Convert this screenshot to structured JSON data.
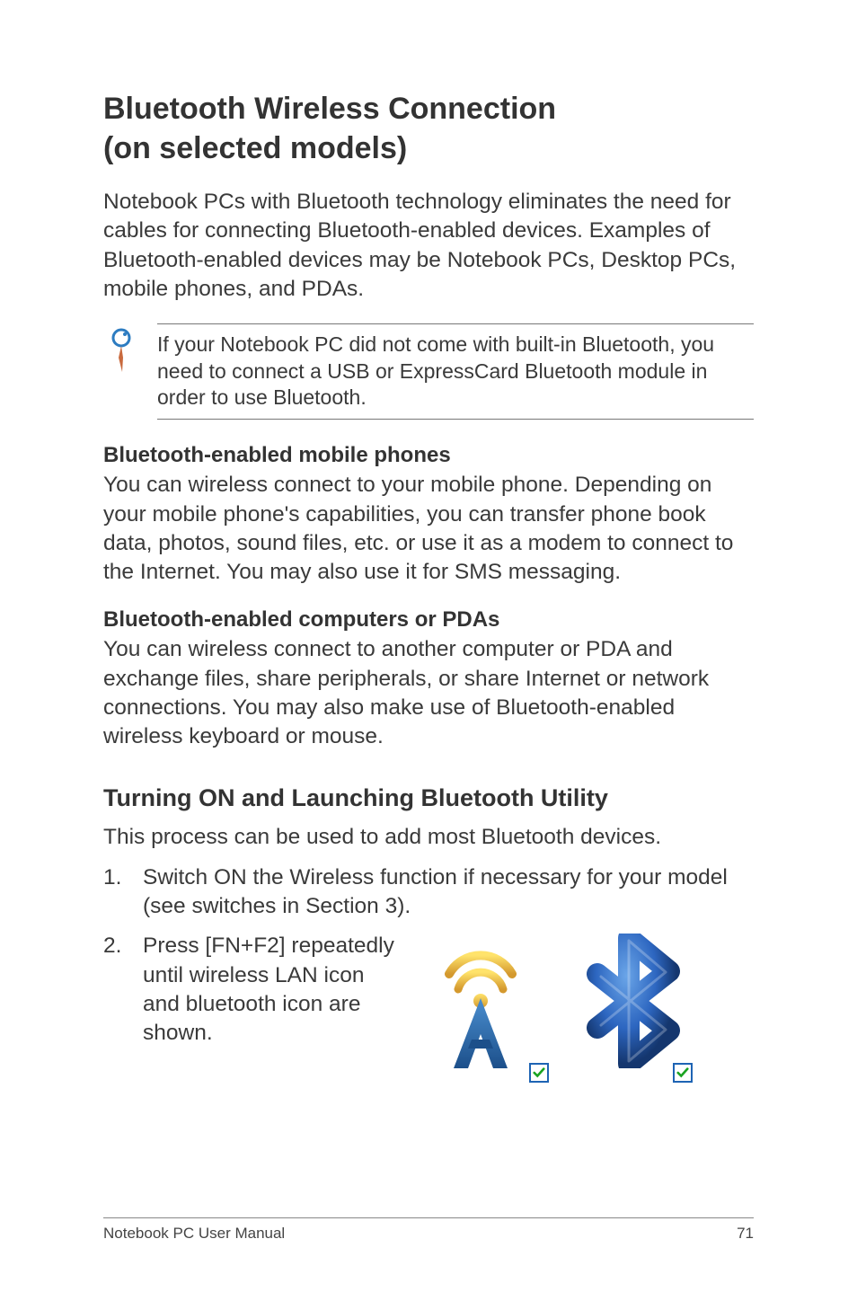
{
  "title_line1": "Bluetooth Wireless Connection",
  "title_line2": "(on selected models)",
  "intro": "Notebook PCs with Bluetooth technology eliminates the need for cables for connecting Bluetooth-enabled devices. Examples of Bluetooth-enabled devices may be Notebook PCs, Desktop PCs, mobile phones, and PDAs.",
  "note": "If your Notebook PC did not come with built-in Bluetooth, you need to connect a USB or ExpressCard Bluetooth module in order to use Bluetooth.",
  "sections": [
    {
      "heading": "Bluetooth-enabled mobile phones",
      "body": "You can wireless connect to your mobile phone. Depending on your mobile phone's capabilities, you can transfer phone book data, photos, sound files, etc. or use it as a modem to connect to the Internet. You may also use it for SMS messaging."
    },
    {
      "heading": "Bluetooth-enabled computers or PDAs",
      "body": "You can wireless connect to another computer or PDA and exchange files, share peripherals, or share Internet or network connections. You may also make use of Bluetooth-enabled wireless keyboard or mouse."
    }
  ],
  "subheading": "Turning ON and Launching Bluetooth Utility",
  "subintro": "This process can be used to add most Bluetooth devices.",
  "steps": [
    {
      "num": "1.",
      "text": "Switch ON the Wireless function if necessary for your model (see switches in Section 3)."
    },
    {
      "num": "2.",
      "text": "Press [FN+F2] repeatedly until wireless LAN icon and bluetooth icon are shown."
    }
  ],
  "footer_left": "Notebook PC User Manual",
  "footer_right": "71"
}
